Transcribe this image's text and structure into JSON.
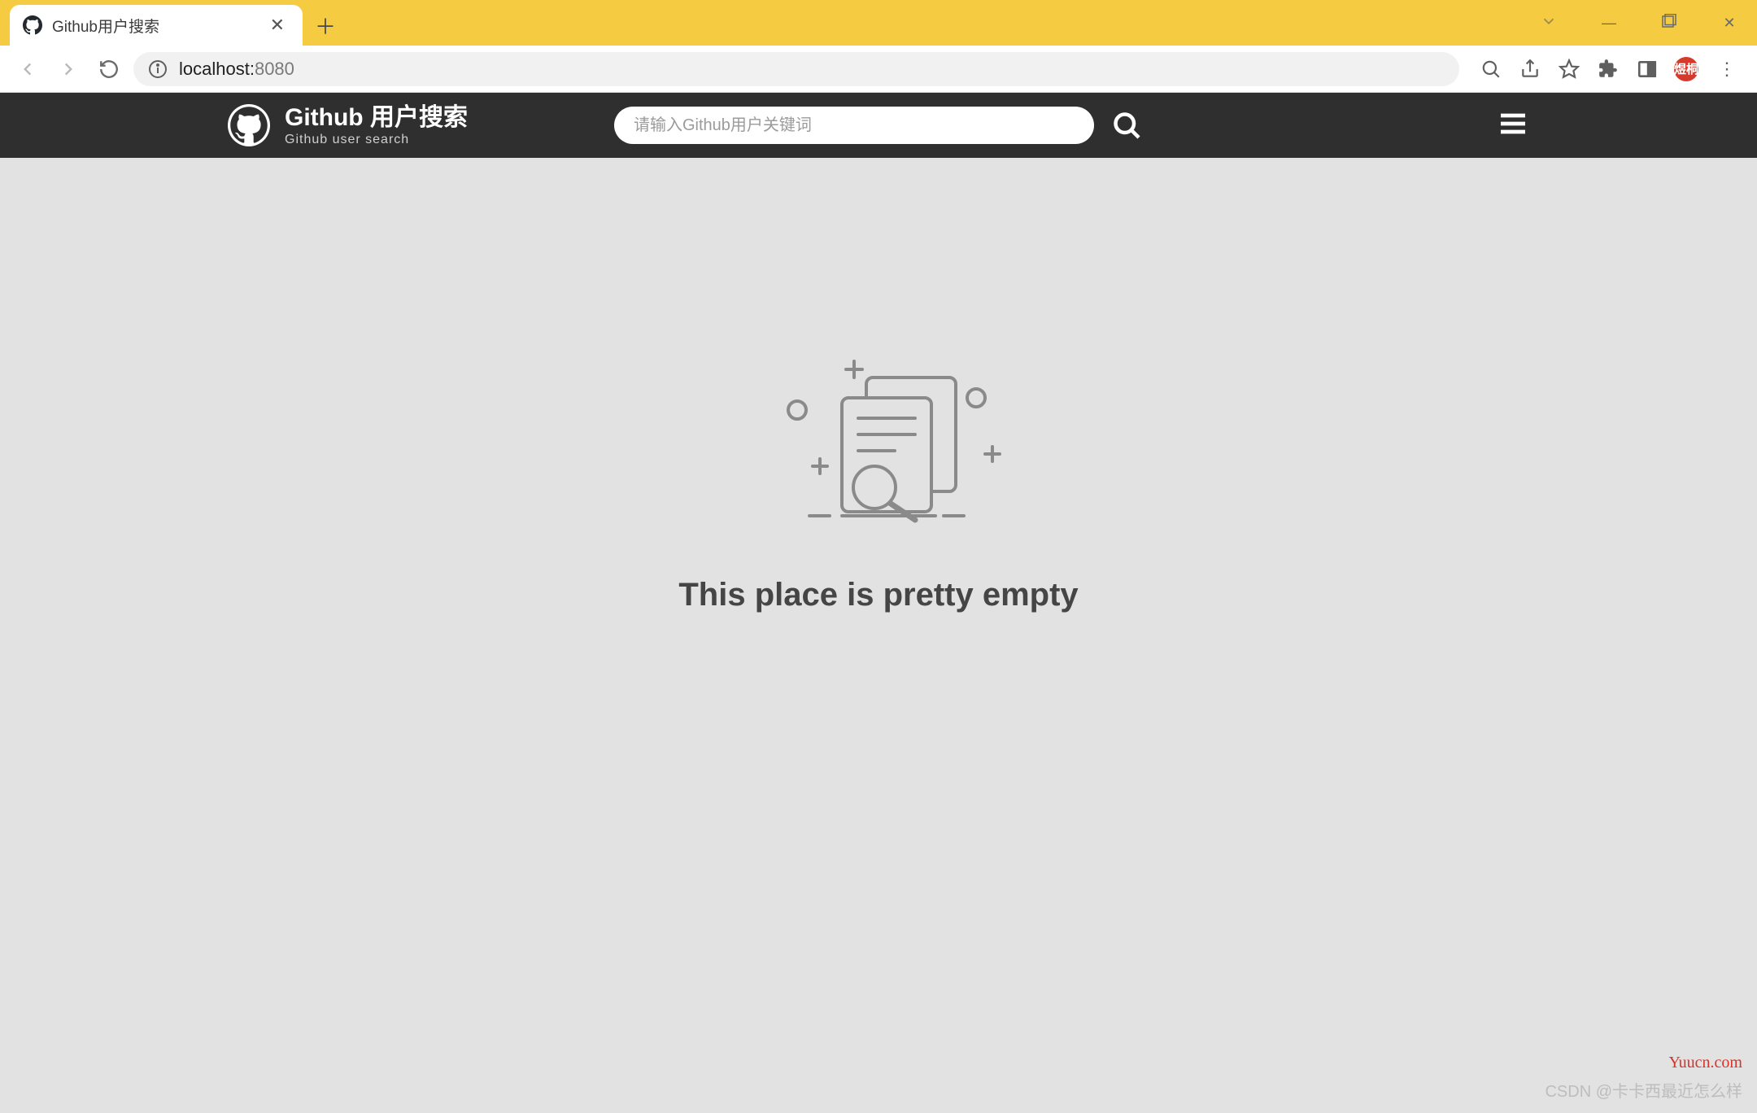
{
  "browser": {
    "tab_title": "Github用户搜索",
    "url_host": "localhost:",
    "url_port": "8080",
    "profile_badge": "煜桐"
  },
  "header": {
    "title": "Github 用户搜索",
    "subtitle": "Github user search",
    "search_placeholder": "请输入Github用户关键词"
  },
  "main": {
    "empty_message": "This place is pretty empty"
  },
  "watermark": {
    "site": "Yuucn.com",
    "author": "CSDN @卡卡西最近怎么样"
  }
}
